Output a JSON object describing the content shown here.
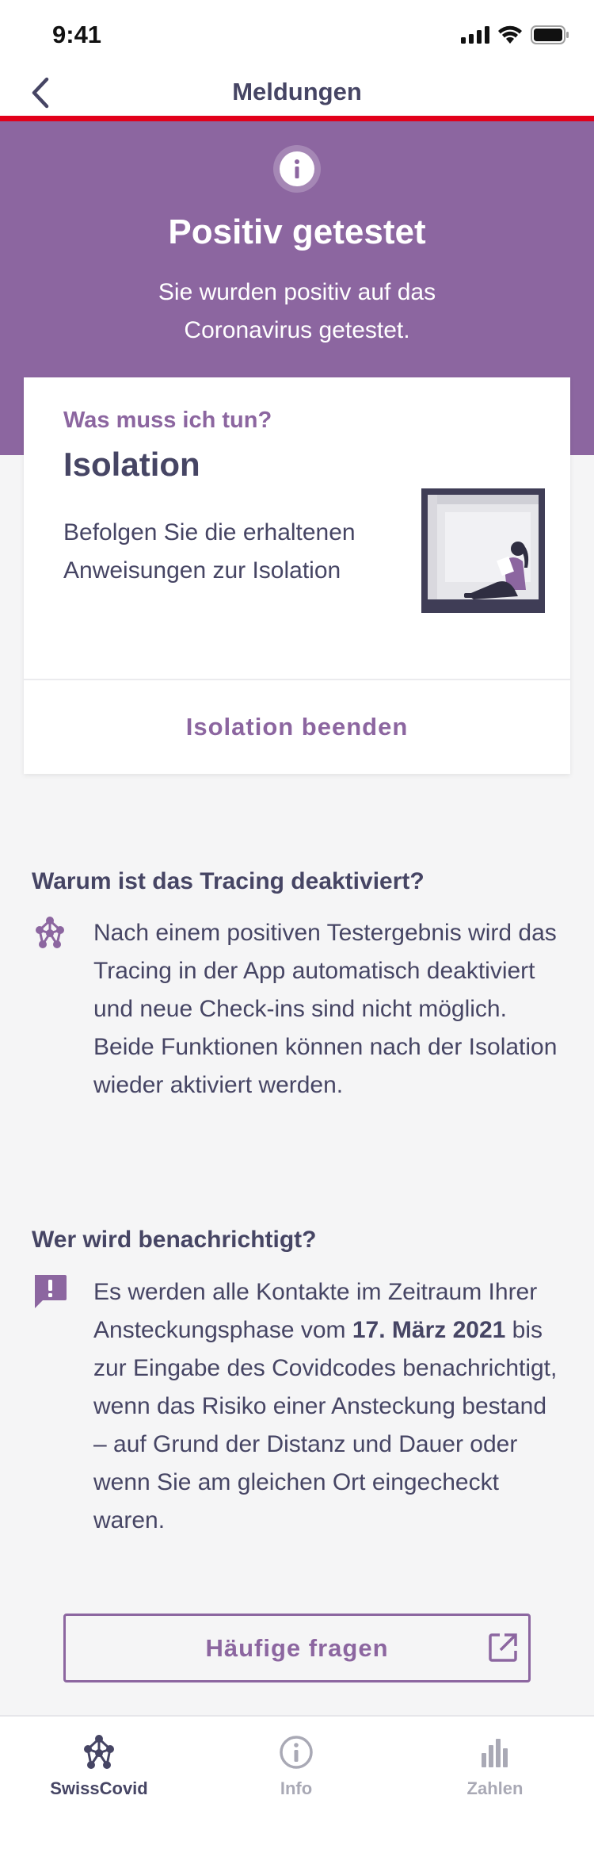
{
  "status_bar": {
    "time": "9:41"
  },
  "nav": {
    "title": "Meldungen"
  },
  "hero": {
    "title": "Positiv getestet",
    "subtitle": "Sie wurden positiv auf das Coronavirus getestet."
  },
  "card": {
    "question": "Was muss ich tun?",
    "heading": "Isolation",
    "body": "Befolgen Sie die erhaltenen Anweisungen zur Isolation",
    "action_label": "Isolation beenden"
  },
  "tracing_section": {
    "title": "Warum ist das Tracing deaktiviert?",
    "text": "Nach einem positiven Testergebnis wird das Tracing in der App automatisch deaktiviert und neue Check-ins sind nicht möglich. Beide Funktionen können nach der Isolation wieder aktiviert werden."
  },
  "notify_section": {
    "title": "Wer wird benachrichtigt?",
    "text_before": "Es werden alle Kontakte im Zeitraum Ihrer Ansteckungsphase vom ",
    "date": "17. März 2021",
    "text_after": " bis zur Eingabe des Covidcodes benachrichtigt, wenn das Risiko einer Ansteckung bestand – auf Grund der Distanz und Dauer oder wenn Sie am gleichen Ort eingecheckt waren."
  },
  "faq_button": {
    "label": "Häufige fragen"
  },
  "tabbar": {
    "tabs": [
      {
        "label": "SwissCovid",
        "icon": "network-icon",
        "active": true
      },
      {
        "label": "Info",
        "icon": "info-icon",
        "active": false
      },
      {
        "label": "Zahlen",
        "icon": "bar-chart-icon",
        "active": false
      }
    ]
  },
  "colors": {
    "brand_purple": "#8c66a0",
    "text_dark": "#464564",
    "alert_red": "#e2001a",
    "background": "#f5f5f6"
  }
}
